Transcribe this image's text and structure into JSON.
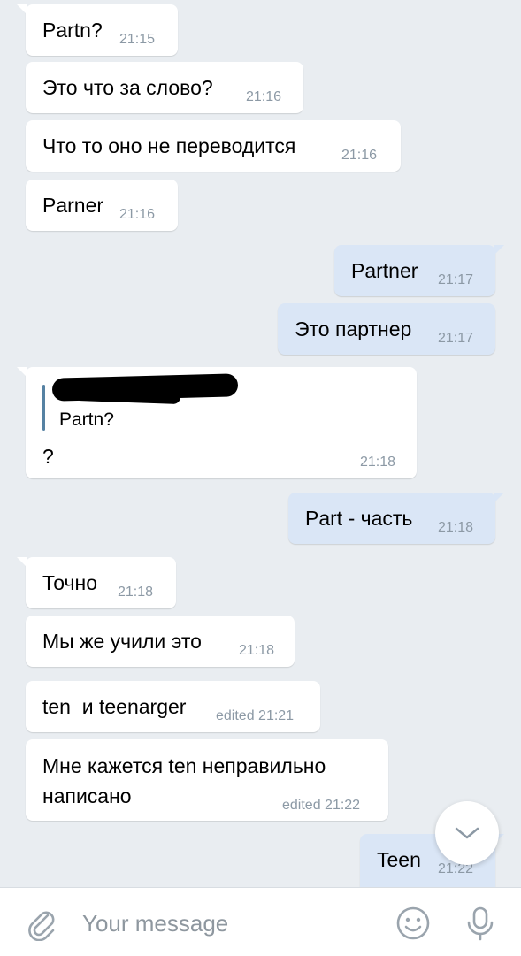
{
  "messages": [
    {
      "text": "Partn?",
      "time": "21:15"
    },
    {
      "text": "Это что за слово?",
      "time": "21:16"
    },
    {
      "text": "Что то оно не переводится",
      "time": "21:16"
    },
    {
      "text": "Parner",
      "time": "21:16"
    },
    {
      "text": "Partner",
      "time": "21:17"
    },
    {
      "text": "Это партнер",
      "time": "21:17"
    },
    {
      "reply_quote": "Partn?",
      "text": "?",
      "time": "21:18"
    },
    {
      "text": "Part - часть",
      "time": "21:18"
    },
    {
      "text": "Точно",
      "time": "21:18"
    },
    {
      "text": "Мы же учили это",
      "time": "21:18"
    },
    {
      "text": "ten  и teenarger",
      "time": "edited 21:21"
    },
    {
      "line1": "Мне кажется ten неправильно",
      "line2": "написано",
      "time": "edited 21:22"
    },
    {
      "text": "Teen",
      "time": "21:22"
    }
  ],
  "composer": {
    "placeholder": "Your message",
    "attach_icon": "paperclip-icon",
    "emoji_icon": "smile-icon",
    "mic_icon": "microphone-icon"
  },
  "scroll_button_icon": "chevron-down-icon",
  "colors": {
    "background": "#e9edf1",
    "incoming_bubble": "#ffffff",
    "outgoing_bubble": "#dae6f6",
    "timestamp": "#8c99a5",
    "reply_bar": "#5682a3"
  }
}
